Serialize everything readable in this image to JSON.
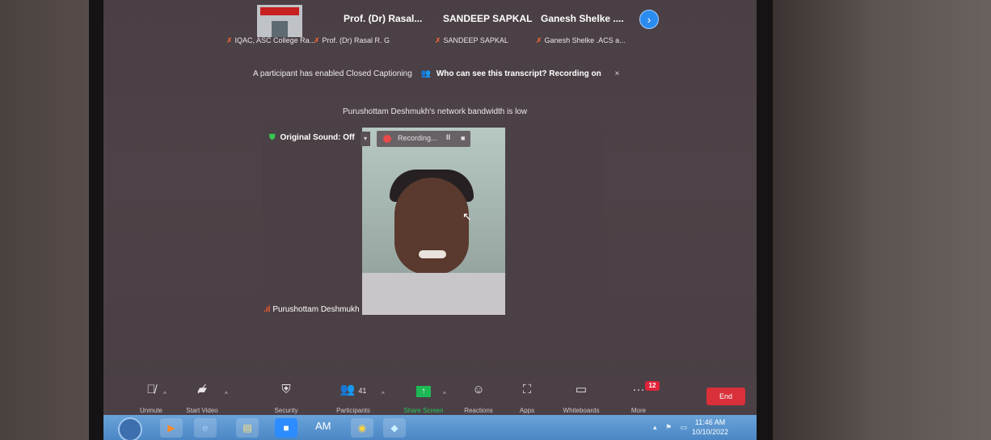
{
  "gallery": {
    "next_icon": "chevron-right-icon",
    "participants": [
      {
        "name": "Prof. (Dr) Rasal...",
        "label": "IQAC, ASC College Ra..."
      },
      {
        "name": "SANDEEP SAPKAL",
        "label": "Prof. (Dr) Rasal R. G"
      },
      {
        "name": "Ganesh Shelke ....",
        "label": "SANDEEP SAPKAL"
      },
      {
        "name": "",
        "label": "Ganesh Shelke .ACS a..."
      }
    ]
  },
  "notices": {
    "caption": "A participant has enabled Closed Captioning",
    "caption_link": "Who can see this transcript? Recording on",
    "caption_close": "×",
    "bandwidth": "Purushottam Deshmukh's network bandwidth is low"
  },
  "video": {
    "original_sound": "Original Sound: Off",
    "recording": "Recording...",
    "pause": "II",
    "stop": "■",
    "speaker_name": "Purushottam Deshmukh"
  },
  "toolbar": {
    "unmute": "Unmute",
    "start_video": "Start Video",
    "security": "Security",
    "participants": "Participants",
    "participants_count": "41",
    "share_screen": "Share Screen",
    "reactions": "Reactions",
    "apps": "Apps",
    "whiteboards": "Whiteboards",
    "more": "More",
    "more_badge": "12",
    "end": "End"
  },
  "taskbar": {
    "am_label": "AM",
    "time": "11:46 AM",
    "date": "10/10/2022"
  },
  "colors": {
    "share_green": "#1db955",
    "end_red": "#d9303a",
    "badge_red": "#e0243a",
    "zoom_blue": "#2b8cf0"
  }
}
